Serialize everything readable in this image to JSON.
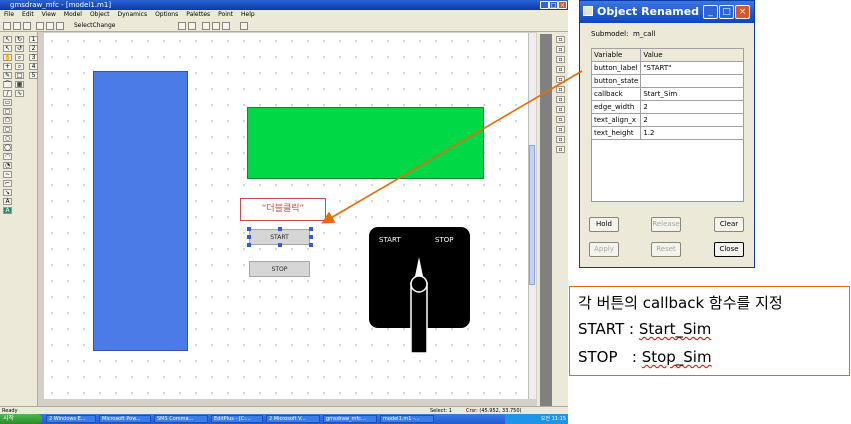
{
  "app": {
    "title": "gmsdraw_mfc - [model1.m1]",
    "menu": [
      "File",
      "Edit",
      "View",
      "Model",
      "Object",
      "Dynamics",
      "Options",
      "Palettes",
      "Point",
      "Help"
    ],
    "toolbar_select": "SelectChange",
    "palette_numbers": [
      "1",
      "2",
      "3",
      "4",
      "5"
    ],
    "status_left": "Ready",
    "status_select": "Select: 1",
    "status_coords": "Crsr: (45.952, 33.750)"
  },
  "canvas": {
    "start_button": "START",
    "stop_button": "STOP",
    "callout": "“더블클릭”",
    "switch_start": "START",
    "switch_stop": "STOP",
    "colors": {
      "blue_rect": "#4a7be6",
      "green_rect": "#00d845",
      "callout_border": "#c0504d",
      "arrow": "#e46c0a"
    }
  },
  "taskbar": {
    "start": "시작",
    "tasks": [
      "2 Windows E...",
      "Microsoft Pow...",
      "SMS Comma...",
      "EditPlus - [C:...",
      "2 Microsoft V...",
      "gmsdraw_mfc...",
      "model1.m1 -..."
    ],
    "clock": "오전 11:15"
  },
  "dialog": {
    "title": "Object Renamed V...",
    "submodel_label": "Submodel:",
    "submodel_value": "m_call",
    "columns": [
      "Variable",
      "Value"
    ],
    "rows": [
      {
        "variable": "button_label",
        "value": "\"START\""
      },
      {
        "variable": "button_state",
        "value": ""
      },
      {
        "variable": "callback",
        "value": "Start_Sim"
      },
      {
        "variable": "edge_width",
        "value": "2"
      },
      {
        "variable": "text_align_x",
        "value": "2"
      },
      {
        "variable": "text_height",
        "value": "1.2"
      }
    ],
    "buttons": {
      "hold": "Hold",
      "release": "Release",
      "clear": "Clear",
      "apply": "Apply",
      "reset": "Reset",
      "close": "Close"
    }
  },
  "note": {
    "line1": "각 버튼의 callback 함수를 지정",
    "start_label": "START",
    "start_sep": " : ",
    "start_value": "Start_Sim",
    "stop_label": "STOP",
    "stop_sep": "   : ",
    "stop_value": "Stop_Sim"
  }
}
